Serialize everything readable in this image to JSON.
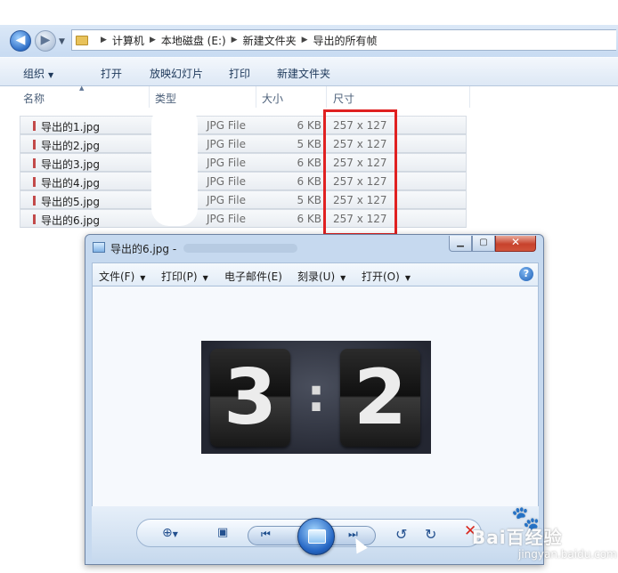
{
  "breadcrumb": [
    "计算机",
    "本地磁盘 (E:)",
    "新建文件夹",
    "导出的所有帧"
  ],
  "toolbar": {
    "organize": "组织",
    "open": "打开",
    "slideshow": "放映幻灯片",
    "print": "打印",
    "new_folder": "新建文件夹"
  },
  "columns": {
    "name": "名称",
    "type": "类型",
    "size": "大小",
    "dimensions": "尺寸"
  },
  "files": [
    {
      "name": "导出的1.jpg",
      "type": "JPG File",
      "size": "6 KB",
      "dimensions": "257 x 127"
    },
    {
      "name": "导出的2.jpg",
      "type": "JPG File",
      "size": "5 KB",
      "dimensions": "257 x 127"
    },
    {
      "name": "导出的3.jpg",
      "type": "JPG File",
      "size": "6 KB",
      "dimensions": "257 x 127"
    },
    {
      "name": "导出的4.jpg",
      "type": "JPG File",
      "size": "6 KB",
      "dimensions": "257 x 127"
    },
    {
      "name": "导出的5.jpg",
      "type": "JPG File",
      "size": "5 KB",
      "dimensions": "257 x 127"
    },
    {
      "name": "导出的6.jpg",
      "type": "JPG File",
      "size": "6 KB",
      "dimensions": "257 x 127"
    }
  ],
  "viewer": {
    "title": "导出的6.jpg -",
    "menu": {
      "file": "文件(F)",
      "print": "打印(P)",
      "email": "电子邮件(E)",
      "burn": "刻录(U)",
      "open": "打开(O)"
    },
    "photo": {
      "left_digit": "3",
      "separator": ":",
      "right_digit": "2"
    }
  },
  "watermark": {
    "brand": "Bai百经验",
    "url": "jingyan.baidu.com"
  },
  "colors": {
    "highlight": "#e02121",
    "delete": "#d9261c"
  },
  "icons": [
    "back-icon",
    "forward-icon",
    "folder-icon",
    "help-icon",
    "zoom-icon",
    "actual-size-icon",
    "previous-icon",
    "slideshow-icon",
    "next-icon",
    "rotate-ccw-icon",
    "rotate-cw-icon",
    "delete-icon"
  ]
}
